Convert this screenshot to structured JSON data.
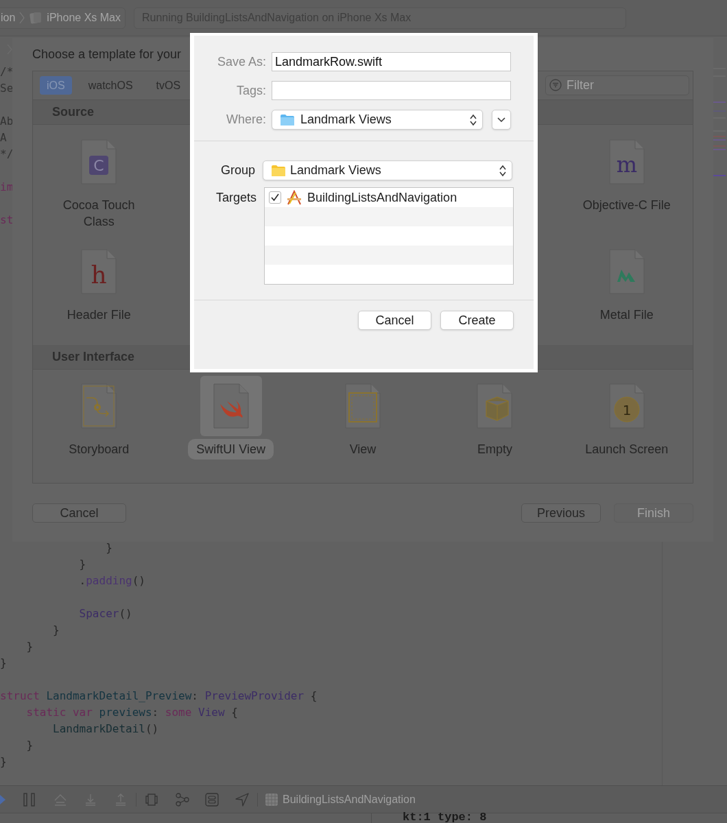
{
  "toolbar": {
    "breadcrumb": [
      "ion",
      "iPhone Xs Max"
    ],
    "activity": "Running BuildingListsAndNavigation on iPhone Xs Max"
  },
  "editor": {
    "top_blocks": [
      [
        {
          "tokens": [
            {
              "t": "/*",
              "kind": "comment"
            }
          ]
        },
        {
          "tokens": [
            {
              "t": "Se",
              "kind": "comment"
            }
          ]
        }
      ],
      [
        {
          "tokens": [
            {
              "t": "Ab",
              "kind": "comment"
            }
          ]
        },
        {
          "tokens": [
            {
              "t": "A",
              "kind": "comment"
            }
          ]
        },
        {
          "tokens": [
            {
              "t": "*/",
              "kind": "comment"
            }
          ]
        }
      ],
      [
        {
          "tokens": [
            {
              "t": "im",
              "kind": "keyword"
            }
          ]
        }
      ],
      [
        {
          "tokens": [
            {
              "t": "st",
              "kind": "keyword"
            }
          ]
        }
      ]
    ],
    "bottom_blocks": [
      [
        {
          "tokens": [
            {
              "t": "                }",
              "kind": "plain"
            }
          ]
        },
        {
          "tokens": [
            {
              "t": "            }",
              "kind": "plain"
            }
          ]
        },
        {
          "tokens": [
            {
              "t": "            .",
              "kind": "plain"
            },
            {
              "t": "padding",
              "kind": "method"
            },
            {
              "t": "()",
              "kind": "plain"
            }
          ]
        }
      ],
      [
        {
          "tokens": [
            {
              "t": "            Spacer",
              "kind": "type"
            },
            {
              "t": "()",
              "kind": "plain"
            }
          ]
        },
        {
          "tokens": [
            {
              "t": "        }",
              "kind": "plain"
            }
          ]
        },
        {
          "tokens": [
            {
              "t": "    }",
              "kind": "plain"
            }
          ]
        },
        {
          "tokens": [
            {
              "t": "}",
              "kind": "plain"
            }
          ]
        }
      ],
      [
        {
          "tokens": [
            {
              "t": "struct ",
              "kind": "keyword"
            },
            {
              "t": "LandmarkDetail_Preview",
              "kind": "ident"
            },
            {
              "t": ": ",
              "kind": "plain"
            },
            {
              "t": "PreviewProvider",
              "kind": "type"
            },
            {
              "t": " {",
              "kind": "plain"
            }
          ]
        },
        {
          "tokens": [
            {
              "t": "    static ",
              "kind": "keyword"
            },
            {
              "t": "var ",
              "kind": "keyword"
            },
            {
              "t": "previews",
              "kind": "ident"
            },
            {
              "t": ": ",
              "kind": "plain"
            },
            {
              "t": "some ",
              "kind": "keyword"
            },
            {
              "t": "View",
              "kind": "type"
            },
            {
              "t": " {",
              "kind": "plain"
            }
          ]
        },
        {
          "tokens": [
            {
              "t": "        LandmarkDetail",
              "kind": "call"
            },
            {
              "t": "()",
              "kind": "plain"
            }
          ]
        },
        {
          "tokens": [
            {
              "t": "    }",
              "kind": "plain"
            }
          ]
        },
        {
          "tokens": [
            {
              "t": "}",
              "kind": "plain"
            }
          ]
        }
      ]
    ]
  },
  "template_sheet": {
    "title": "Choose a template for your",
    "tabs": [
      {
        "label": "iOS",
        "selected": true
      },
      {
        "label": "watchOS",
        "selected": false
      },
      {
        "label": "tvOS",
        "selected": false
      }
    ],
    "filter": {
      "placeholder": "Filter"
    },
    "sections": [
      {
        "title": "Source",
        "templates": [
          {
            "label": "Cocoa Touch Class",
            "kind": "class",
            "glyph": "C",
            "selected": false
          },
          {
            "label": "Objective-C File",
            "kind": "objc",
            "glyph": "m",
            "selected": false
          },
          {
            "label": "Header File",
            "kind": "header",
            "glyph": "h",
            "selected": false
          },
          {
            "label": "Metal File",
            "kind": "metal",
            "selected": false
          }
        ]
      },
      {
        "title": "User Interface",
        "templates": [
          {
            "label": "Storyboard",
            "kind": "storyboard",
            "selected": false
          },
          {
            "label": "SwiftUI View",
            "kind": "swiftui",
            "selected": true
          },
          {
            "label": "View",
            "kind": "view",
            "selected": false
          },
          {
            "label": "Empty",
            "kind": "empty",
            "selected": false
          },
          {
            "label": "Launch Screen",
            "kind": "launch",
            "glyph": "1",
            "selected": false
          }
        ]
      }
    ],
    "buttons": [
      {
        "label": "Cancel",
        "disabled": false
      },
      {
        "label": "Previous",
        "disabled": false
      },
      {
        "label": "Finish",
        "disabled": true
      }
    ]
  },
  "save_dialog": {
    "fields": [
      {
        "label": "Save As:",
        "kind": "text",
        "value": "LandmarkRow.swift"
      },
      {
        "label": "Tags:",
        "kind": "text"
      },
      {
        "label": "Where:",
        "kind": "location",
        "value": "Landmark Views"
      }
    ],
    "group": {
      "label": "Group",
      "value": "Landmark Views"
    },
    "targets": {
      "label": "Targets",
      "items": [
        {
          "label": "BuildingListsAndNavigation",
          "checked": true
        }
      ]
    },
    "buttons": [
      {
        "label": "Cancel",
        "default": false
      },
      {
        "label": "Create",
        "default": false
      }
    ]
  },
  "debug_bar": {
    "buttons": [
      {
        "kind": "continue",
        "disabled": false
      },
      {
        "kind": "pause",
        "disabled": false
      },
      {
        "kind": "step_over",
        "disabled": true
      },
      {
        "kind": "step_in",
        "disabled": true
      },
      {
        "kind": "step_out",
        "disabled": true
      },
      {
        "kind": "view_debugger",
        "disabled": false
      },
      {
        "kind": "memory_graph",
        "disabled": false
      },
      {
        "kind": "environment",
        "disabled": false
      },
      {
        "kind": "location",
        "disabled": false
      }
    ],
    "target": "BuildingListsAndNavigation"
  },
  "console": {
    "text": "kt:1 type: 8"
  }
}
